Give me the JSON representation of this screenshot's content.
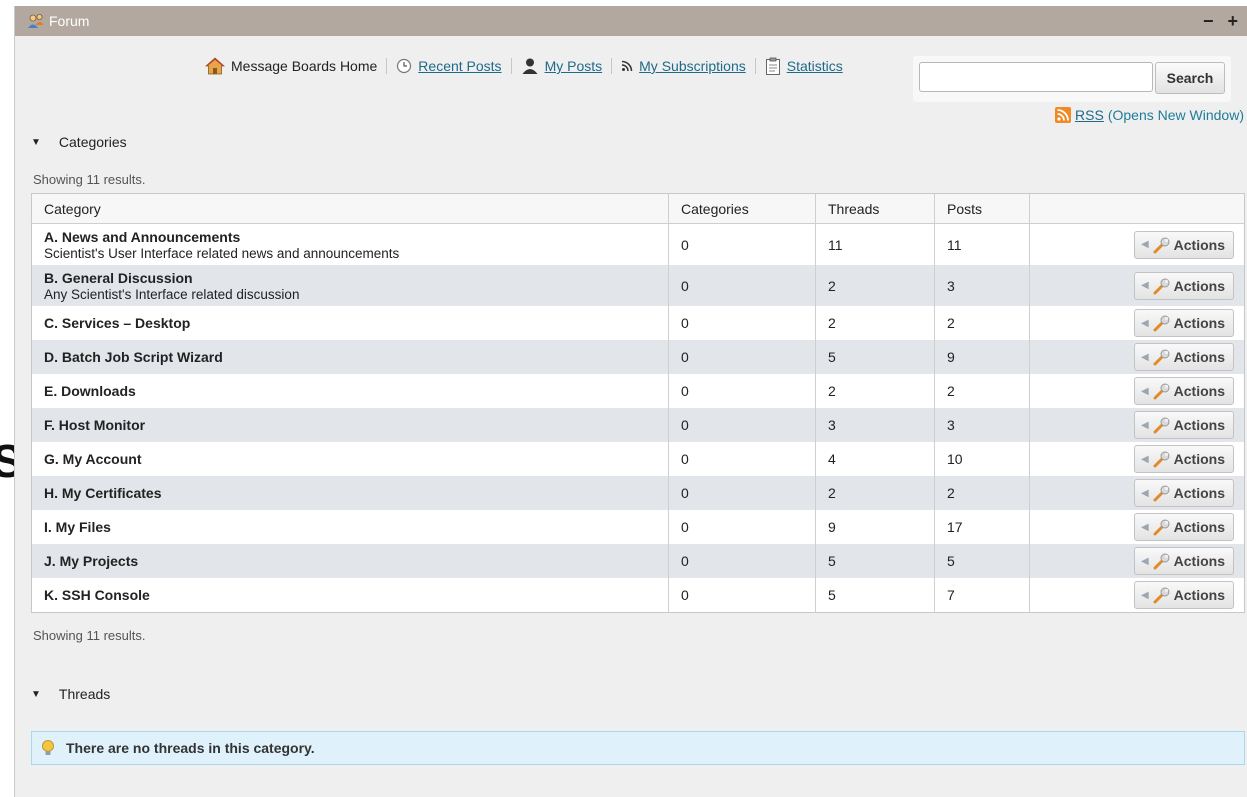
{
  "window": {
    "title": "Forum",
    "minimize": "−",
    "maximize": "+"
  },
  "nav": {
    "home": "Message Boards Home",
    "recent": "Recent Posts",
    "myposts": "My Posts",
    "subs": "My Subscriptions",
    "stats": "Statistics"
  },
  "search": {
    "value": "",
    "button": "Search"
  },
  "rss": {
    "label": "RSS",
    "note": "(Opens New Window)"
  },
  "categories_section": {
    "label": "Categories",
    "showing": "Showing 11 results."
  },
  "table": {
    "headers": [
      "Category",
      "Categories",
      "Threads",
      "Posts",
      ""
    ],
    "action_label": "Actions",
    "rows": [
      {
        "name": "A. News and Announcements",
        "desc": "Scientist's User Interface related news and announcements",
        "categories": "0",
        "threads": "11",
        "posts": "11"
      },
      {
        "name": "B. General Discussion",
        "desc": "Any Scientist's Interface related discussion",
        "categories": "0",
        "threads": "2",
        "posts": "3"
      },
      {
        "name": "C. Services – Desktop",
        "desc": "",
        "categories": "0",
        "threads": "2",
        "posts": "2"
      },
      {
        "name": "D. Batch Job Script Wizard",
        "desc": "",
        "categories": "0",
        "threads": "5",
        "posts": "9"
      },
      {
        "name": "E. Downloads",
        "desc": "",
        "categories": "0",
        "threads": "2",
        "posts": "2"
      },
      {
        "name": "F. Host Monitor",
        "desc": "",
        "categories": "0",
        "threads": "3",
        "posts": "3"
      },
      {
        "name": "G. My Account",
        "desc": "",
        "categories": "0",
        "threads": "4",
        "posts": "10"
      },
      {
        "name": "H. My Certificates",
        "desc": "",
        "categories": "0",
        "threads": "2",
        "posts": "2"
      },
      {
        "name": "I. My Files",
        "desc": "",
        "categories": "0",
        "threads": "9",
        "posts": "17"
      },
      {
        "name": "J. My Projects",
        "desc": "",
        "categories": "0",
        "threads": "5",
        "posts": "5"
      },
      {
        "name": "K. SSH Console",
        "desc": "",
        "categories": "0",
        "threads": "5",
        "posts": "7"
      }
    ]
  },
  "threads_section": {
    "label": "Threads",
    "notice": "There are no threads in this category."
  },
  "background": {
    "letter": "S"
  }
}
